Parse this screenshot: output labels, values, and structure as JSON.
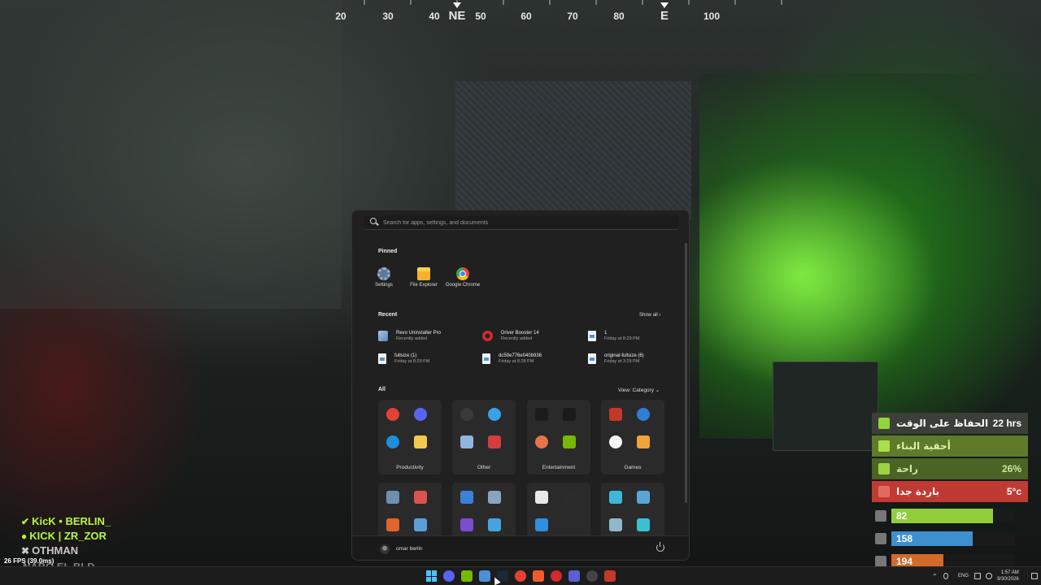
{
  "compass": {
    "labels": [
      "20",
      "30",
      "40",
      "NE",
      "50",
      "60",
      "70",
      "80",
      "E",
      "100"
    ]
  },
  "start_menu": {
    "search_placeholder": "Search for apps, settings, and documents",
    "pinned_title": "Pinned",
    "pinned": [
      {
        "label": "Settings",
        "icon": "gear-icon"
      },
      {
        "label": "File Explorer",
        "icon": "folder-icon"
      },
      {
        "label": "Google Chrome",
        "icon": "chrome-icon"
      }
    ],
    "recent_title": "Recent",
    "show_all": "Show all  ›",
    "recent": [
      {
        "name": "Revo Uninstaller Pro",
        "sub": "Recently added",
        "icon": "revo-icon"
      },
      {
        "name": "Driver Booster 14",
        "sub": "Recently added",
        "icon": "booster-icon"
      },
      {
        "name": "1",
        "sub": "Friday at 8:29 PM",
        "icon": "doc-icon"
      },
      {
        "name": "fullsize (1)",
        "sub": "Friday at 8:29 PM",
        "icon": "doc-icon"
      },
      {
        "name": "dc59e776e040b936",
        "sub": "Friday at 8:28 PM",
        "icon": "doc-icon"
      },
      {
        "name": "original-fullsize (6)",
        "sub": "Friday at 3:26 PM",
        "icon": "doc-icon"
      }
    ],
    "all_title": "All",
    "view_category": "View: Category  ⌄",
    "categories": [
      {
        "name": "Productivity",
        "icons": [
          "chrome-icon",
          "discord-icon",
          "edge-icon",
          "store-icon"
        ],
        "colors": [
          "#e44134",
          "#5865f2",
          "#1d8fe0",
          "#f2c94c"
        ]
      },
      {
        "name": "Other",
        "icons": [
          "obs-icon",
          "browser-icon",
          "revo-icon",
          "apps-icon"
        ],
        "colors": [
          "#3a3a3a",
          "#3aa0e8",
          "#8fb6e0",
          "#d63c3c"
        ]
      },
      {
        "name": "Entertainment",
        "icons": [
          "epic-games-icon",
          "audio-icon",
          "media-player-icon",
          "nvidia-icon"
        ],
        "colors": [
          "#1b1b1b",
          "#1b1b1b",
          "#e8734a",
          "#76b900"
        ]
      },
      {
        "name": "Games",
        "icons": [
          "game-icon",
          "update-icon",
          "ea-icon",
          "xbox-icon"
        ],
        "colors": [
          "#c0392b",
          "#2f7ed8",
          "#f5f5f5",
          "#f2a33a"
        ]
      }
    ],
    "lower_categories": [
      {
        "icons": [
          "gear-icon",
          "control-panel-icon",
          "folder-icon",
          "installer-icon"
        ],
        "colors": [
          "#6d8fb2",
          "#d9534f",
          "#e0642b",
          "#5a9fd6"
        ]
      },
      {
        "icons": [
          "paint-icon",
          "camera-icon",
          "clipchamp-icon",
          "globe-icon"
        ],
        "colors": [
          "#3a82d8",
          "#8aa4c0",
          "#7e4ccf",
          "#47a3e0"
        ]
      },
      {
        "icons": [
          "chatgpt-icon",
          "terminal-icon",
          "vscode-icon"
        ],
        "colors": [
          "#e8e8e8",
          "#2b2b2b",
          "#2f8fe0"
        ]
      },
      {
        "icons": [
          "display-icon",
          "remote-icon",
          "network-icon",
          "people-icon"
        ],
        "colors": [
          "#3fb8d8",
          "#58a6d8",
          "#8fb8c8",
          "#3cc0d0"
        ]
      }
    ],
    "user_name": "omar berlin"
  },
  "chat": [
    {
      "mark": "✔",
      "text": "KicK • BERLIN_",
      "color": "#b7f542"
    },
    {
      "mark": "●",
      "text": "KICK | ZR_ZOR",
      "color": "#b7f542"
    },
    {
      "mark": "✖",
      "text": "OTHMAN",
      "color": "#c8c8c8"
    }
  ],
  "chat_cut": "NABO EL BLD",
  "fps": "26 FPS (39.0ms)",
  "status": [
    {
      "label": "الحفاظ على الوقت",
      "value": "22 hrs",
      "icon": "home-icon",
      "bg": "#3b3f37",
      "color": "#ffffff",
      "icon_color": "#8fd63a"
    },
    {
      "label": "أحقية البناء",
      "value": "",
      "icon": "cube-icon",
      "bg": "#5e7a2a",
      "color": "#d9f5a0",
      "icon_color": "#a8e04a"
    },
    {
      "label": "راحة",
      "value": "26%",
      "icon": "comfort-icon",
      "bg": "#4b6325",
      "color": "#cfe89a",
      "icon_color": "#9ed243"
    },
    {
      "label": "باردة جدا",
      "value": "5°c",
      "icon": "cold-icon",
      "bg": "#c03a34",
      "color": "#ffffff",
      "icon_color": "#e06b62"
    }
  ],
  "stat_bars": [
    {
      "value": "82",
      "fill": 0.82,
      "color": "#8fce3a",
      "icon": "health-icon"
    },
    {
      "value": "158",
      "fill": 0.66,
      "color": "#3d8fcf",
      "icon": "water-icon"
    },
    {
      "value": "194",
      "fill": 0.42,
      "color": "#d26a2a",
      "icon": "food-icon"
    }
  ],
  "taskbar": {
    "apps": [
      {
        "icon": "discord-icon",
        "color": "#5865f2"
      },
      {
        "icon": "nvidia-app-icon",
        "color": "#76b900"
      },
      {
        "icon": "task-manager-icon",
        "color": "#4a90d9"
      },
      {
        "icon": "steam-icon",
        "color": "#1b2838"
      },
      {
        "icon": "chrome-icon",
        "color": "#e44134"
      },
      {
        "icon": "brave-icon",
        "color": "#f25b29"
      },
      {
        "icon": "driver-booster-icon",
        "color": "#d42a2a"
      },
      {
        "icon": "vpn-icon",
        "color": "#5b5fd6"
      },
      {
        "icon": "obs-icon",
        "color": "#444444"
      },
      {
        "icon": "game-icon",
        "color": "#c0392b"
      }
    ],
    "language": "ENG",
    "time": "1:57 AM",
    "date": "9/30/2026"
  }
}
